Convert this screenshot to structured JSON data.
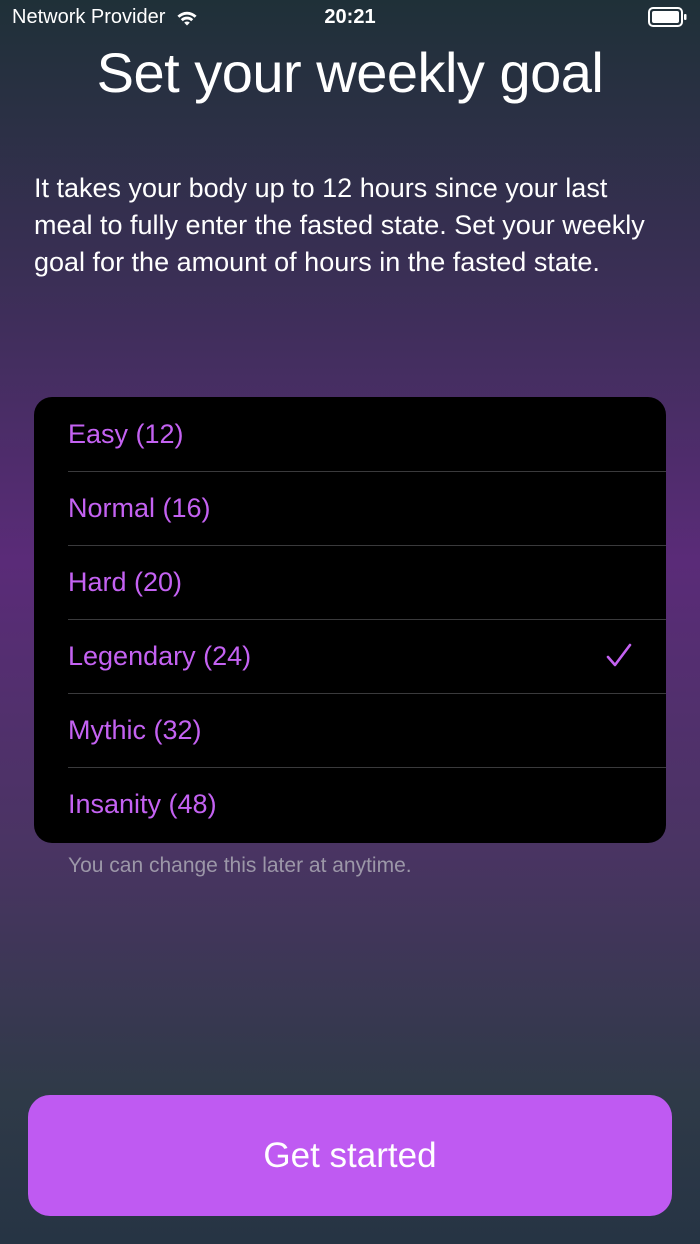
{
  "status_bar": {
    "carrier": "Network Provider",
    "time": "20:21"
  },
  "title": "Set your weekly goal",
  "description": "It takes your body up to 12 hours since your last meal to fully enter the fasted state. Set your weekly goal for the amount of hours in the fasted state.",
  "goals": [
    {
      "label": "Easy (12)",
      "selected": false
    },
    {
      "label": "Normal (16)",
      "selected": false
    },
    {
      "label": "Hard (20)",
      "selected": false
    },
    {
      "label": "Legendary (24)",
      "selected": true
    },
    {
      "label": "Mythic (32)",
      "selected": false
    },
    {
      "label": "Insanity (48)",
      "selected": false
    }
  ],
  "footnote": "You can change this later at anytime.",
  "button_label": "Get started",
  "colors": {
    "accent": "#bf5af2",
    "option_text": "#c462f2",
    "list_background": "#000000"
  }
}
